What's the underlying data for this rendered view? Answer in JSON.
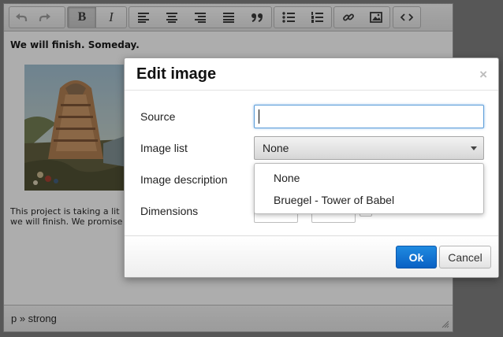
{
  "toolbar": {
    "bold_label": "B",
    "italic_label": "I"
  },
  "document": {
    "heading": "We will finish. Someday.",
    "paragraph_line1": "This project is taking a lit",
    "paragraph_line2": "we will finish. We promise"
  },
  "statusbar": {
    "path": "p » strong"
  },
  "dialog": {
    "title": "Edit image",
    "close_glyph": "×",
    "source_label": "Source",
    "source_value": "",
    "image_list_label": "Image list",
    "image_list_selected": "None",
    "image_description_label": "Image description",
    "dimensions_label": "Dimensions",
    "image_list_options": [
      "None",
      "Bruegel - Tower of Babel"
    ],
    "ok_label": "Ok",
    "cancel_label": "Cancel"
  },
  "colors": {
    "primary_button": "#0a61c4",
    "focus_border": "#5b9dd9",
    "overlay": "#7b7b7b"
  }
}
